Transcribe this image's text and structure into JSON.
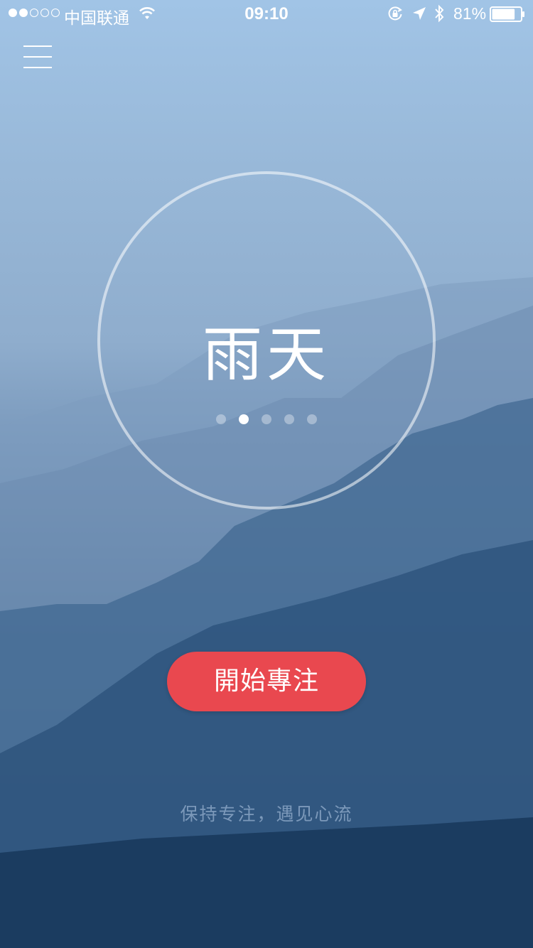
{
  "status_bar": {
    "signal_strength": 2,
    "signal_total": 5,
    "carrier": "中国联通",
    "time": "09:10",
    "battery_percent": "81%",
    "battery_level": 0.81,
    "icons": [
      "wifi-icon",
      "rotation-lock-icon",
      "location-icon",
      "bluetooth-icon",
      "battery-icon"
    ]
  },
  "menu": {
    "icon": "hamburger-menu-icon"
  },
  "mode": {
    "title": "雨天",
    "page_count": 5,
    "active_page": 1
  },
  "start_button": {
    "label": "開始專注",
    "color": "#e9484f"
  },
  "slogan": "保持专注，遇见心流"
}
